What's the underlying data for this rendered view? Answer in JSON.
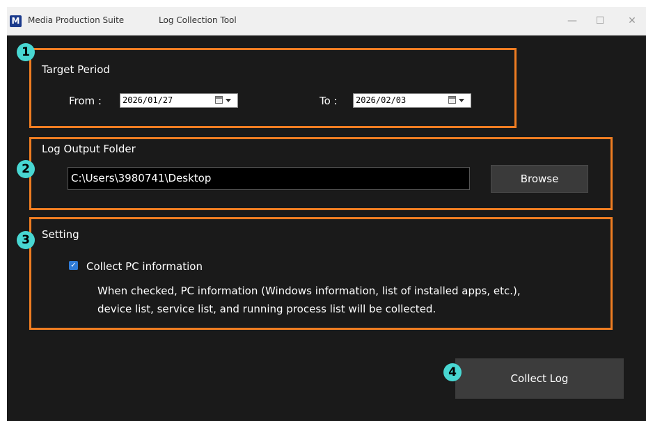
{
  "window": {
    "logo_letter": "M",
    "app_name": "Media Production Suite",
    "tool_name": "Log Collection Tool",
    "controls": {
      "minimize": "—",
      "maximize": "☐",
      "close": "✕"
    }
  },
  "badges": [
    "1",
    "2",
    "3",
    "4"
  ],
  "target_period": {
    "heading": "Target Period",
    "from_label": "From :",
    "from_value": "2026/01/27",
    "to_label": "To :",
    "to_value": "2026/02/03"
  },
  "log_output": {
    "heading": "Log Output Folder",
    "path": "C:\\Users\\3980741\\Desktop",
    "browse_label": "Browse"
  },
  "setting": {
    "heading": "Setting",
    "checkbox_label": "Collect PC information",
    "checkbox_checked": true,
    "checkmark": "✓",
    "description_line1": "When checked, PC information (Windows information, list of installed apps, etc.),",
    "description_line2": "device list, service list, and running process list will be collected."
  },
  "actions": {
    "collect_label": "Collect Log"
  },
  "colors": {
    "highlight": "#ef7d22",
    "badge": "#48d7d2",
    "checkbox": "#2f7bd6",
    "background": "#1a1a1a"
  },
  "icons": [
    "calendar-icon",
    "dropdown-caret-icon",
    "checkmark-icon"
  ]
}
